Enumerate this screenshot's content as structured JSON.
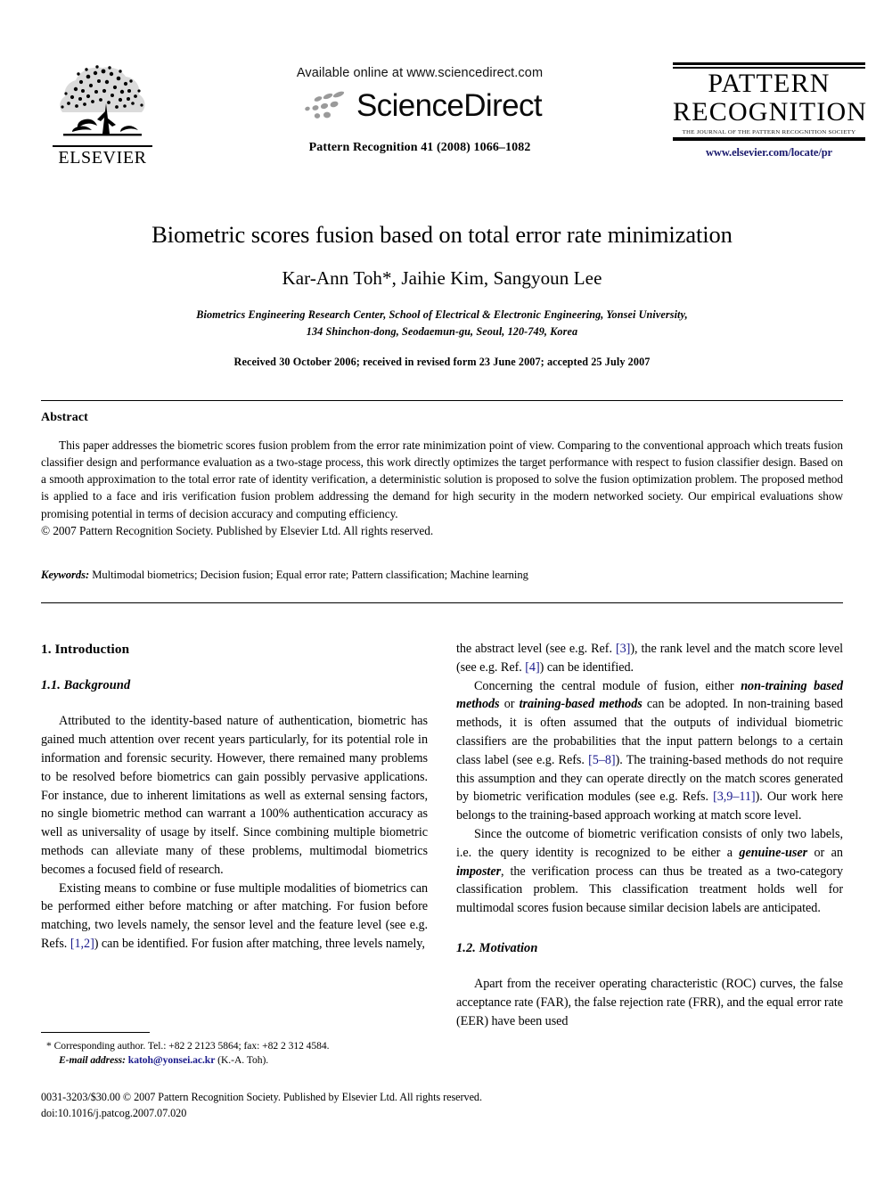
{
  "masthead": {
    "publisher_logo": {
      "name": "ELSEVIER",
      "icon": "elsevier-tree-logo"
    },
    "sciencedirect": {
      "available_line": "Available online at www.sciencedirect.com",
      "brand": "ScienceDirect",
      "icon": "sciencedirect-swoosh-icon"
    },
    "journal_reference": "Pattern Recognition 41 (2008) 1066–1082",
    "journal_logo": {
      "line1": "PATTERN",
      "line2": "RECOGNITION",
      "subtitle": "THE JOURNAL OF THE PATTERN RECOGNITION SOCIETY",
      "url": "www.elsevier.com/locate/pr"
    }
  },
  "title_block": {
    "title": "Biometric scores fusion based on total error rate minimization",
    "authors": "Kar-Ann Toh*, Jaihie Kim, Sangyoun Lee",
    "affiliation_line1": "Biometrics Engineering Research Center, School of Electrical & Electronic Engineering, Yonsei University,",
    "affiliation_line2": "134 Shinchon-dong, Seodaemun-gu, Seoul, 120-749, Korea",
    "received": "Received 30 October 2006; received in revised form 23 June 2007; accepted 25 July 2007"
  },
  "abstract": {
    "heading": "Abstract",
    "body": "This paper addresses the biometric scores fusion problem from the error rate minimization point of view. Comparing to the conventional approach which treats fusion classifier design and performance evaluation as a two-stage process, this work directly optimizes the target performance with respect to fusion classifier design. Based on a smooth approximation to the total error rate of identity verification, a deterministic solution is proposed to solve the fusion optimization problem. The proposed method is applied to a face and iris verification fusion problem addressing the demand for high security in the modern networked society. Our empirical evaluations show promising potential in terms of decision accuracy and computing efficiency.",
    "copyright": "© 2007 Pattern Recognition Society. Published by Elsevier Ltd. All rights reserved."
  },
  "keywords": {
    "label": "Keywords:",
    "list": "Multimodal biometrics; Decision fusion; Equal error rate; Pattern classification; Machine learning"
  },
  "body": {
    "section1_heading": "1.  Introduction",
    "section11_heading": "1.1. Background",
    "section12_heading": "1.2. Motivation",
    "left_p1": "Attributed to the identity-based nature of authentication, biometric has gained much attention over recent years particularly, for its potential role in information and forensic security. However, there remained many problems to be resolved before biometrics can gain possibly pervasive applications. For instance, due to inherent limitations as well as external sensing factors, no single biometric method can warrant a 100% authentication accuracy as well as universality of usage by itself. Since combining multiple biometric methods can alleviate many of these problems, multimodal biometrics becomes a focused field of research.",
    "left_p2_a": "Existing means to combine or fuse multiple modalities of biometrics can be performed either before matching or after matching. For fusion before matching, two levels namely, the sensor level and the feature level (see e.g. Refs. ",
    "left_p2_ref": "[1,2]",
    "left_p2_b": ") can be identified. For fusion after matching, three levels namely,",
    "right_p1_a": "the abstract level (see e.g. Ref. ",
    "right_p1_ref1": "[3]",
    "right_p1_b": "), the rank level and the match score level (see e.g. Ref. ",
    "right_p1_ref2": "[4]",
    "right_p1_c": ") can be identified.",
    "right_p2_a": "Concerning the central module of fusion, either ",
    "right_p2_it1": "non-training based methods",
    "right_p2_b": " or ",
    "right_p2_it2": "training-based methods",
    "right_p2_c": " can be adopted. In non-training based methods, it is often assumed that the outputs of individual biometric classifiers are the probabilities that the input pattern belongs to a certain class label (see e.g. Refs. ",
    "right_p2_ref1": "[5–8]",
    "right_p2_d": "). The training-based methods do not require this assumption and they can operate directly on the match scores generated by biometric verification modules (see e.g. Refs. ",
    "right_p2_ref2": "[3,9–11]",
    "right_p2_e": "). Our work here belongs to the training-based approach working at match score level.",
    "right_p3_a": "Since the outcome of biometric verification consists of only two labels, i.e. the query identity is recognized to be either a ",
    "right_p3_it1": "genuine-user",
    "right_p3_b": " or an ",
    "right_p3_it2": "imposter",
    "right_p3_c": ", the verification process can thus be treated as a two-category classification problem. This classification treatment holds well for multimodal scores fusion because similar decision labels are anticipated.",
    "right_p4": "Apart from the receiver operating characteristic (ROC) curves, the false acceptance rate (FAR), the false rejection rate (FRR), and the equal error rate (EER) have been used"
  },
  "footnote": {
    "corresponding": "* Corresponding author. Tel.: +82 2 2123 5864; fax: +82 2 312 4584.",
    "email_label": "E-mail address:",
    "email": "katoh@yonsei.ac.kr",
    "email_suffix": "(K.-A. Toh)."
  },
  "page_footer": {
    "line1": "0031-3203/$30.00 © 2007 Pattern Recognition Society. Published by Elsevier Ltd. All rights reserved.",
    "line2": "doi:10.1016/j.patcog.2007.07.020"
  },
  "colors": {
    "link": "#1a1a8c",
    "journal_url": "#1a1a6e",
    "text": "#000000"
  }
}
